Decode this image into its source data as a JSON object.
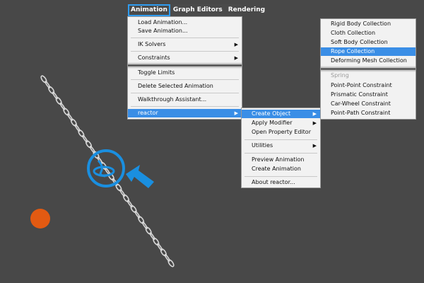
{
  "menubar": {
    "items": [
      {
        "label": "Animation"
      },
      {
        "label": "Graph Editors"
      },
      {
        "label": "Rendering"
      }
    ]
  },
  "animation_menu": {
    "items": [
      {
        "label": "Load Animation..."
      },
      {
        "label": "Save Animation..."
      },
      {
        "label": "IK Solvers"
      },
      {
        "label": "Constraints"
      },
      {
        "label": "Toggle Limits"
      },
      {
        "label": "Delete Selected Animation"
      },
      {
        "label": "Walkthrough Assistant..."
      },
      {
        "label": "reactor"
      }
    ]
  },
  "reactor_menu": {
    "items": [
      {
        "label": "Create Object"
      },
      {
        "label": "Apply Modifier"
      },
      {
        "label": "Open Property Editor"
      },
      {
        "label": "Utilities"
      },
      {
        "label": "Preview Animation"
      },
      {
        "label": "Create Animation"
      },
      {
        "label": "About reactor..."
      }
    ]
  },
  "create_object_menu": {
    "items": [
      {
        "label": "Rigid Body Collection"
      },
      {
        "label": "Cloth Collection"
      },
      {
        "label": "Soft Body Collection"
      },
      {
        "label": "Rope Collection"
      },
      {
        "label": "Deforming Mesh Collection"
      },
      {
        "label": "Spring"
      },
      {
        "label": "Point-Point Constraint"
      },
      {
        "label": "Prismatic Constraint"
      },
      {
        "label": "Car-Wheel Constraint"
      },
      {
        "label": "Point-Path Constraint"
      }
    ]
  },
  "colors": {
    "viewport_bg": "#484848",
    "highlight": "#3a8ee6",
    "callout": "#1a8fe0",
    "dot": "#e25a12"
  },
  "icons": {
    "submenu_arrow": "triangle-right-icon",
    "callout_arrow": "arrow-icon",
    "rope_helper": "rope-collection-icon"
  }
}
